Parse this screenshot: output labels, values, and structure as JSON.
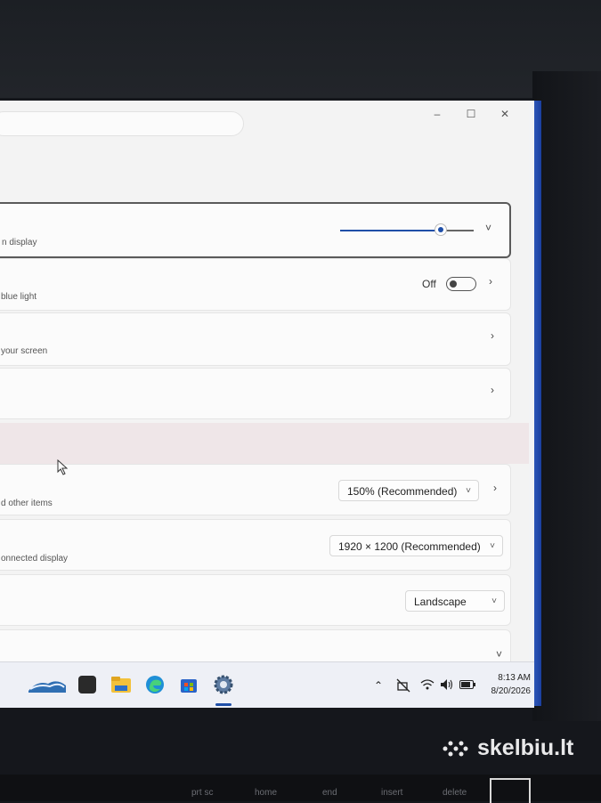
{
  "window": {
    "minimize_glyph": "–",
    "maximize_glyph": "☐",
    "close_glyph": "✕"
  },
  "brightness": {
    "subtitle": "n display",
    "level_percent": 80
  },
  "night_light": {
    "subtitle": "blue light",
    "state_label": "Off"
  },
  "hdr": {
    "subtitle": "your screen"
  },
  "scale": {
    "subtitle": "d other items",
    "value": "150% (Recommended)"
  },
  "resolution": {
    "subtitle": "onnected display",
    "value": "1920 × 1200 (Recommended)"
  },
  "orientation": {
    "value": "Landscape"
  },
  "glyphs": {
    "chevron_right": "›",
    "chevron_down": "˅"
  },
  "taskbar": {
    "icons": [
      "widgets-icon",
      "task-view-icon",
      "file-explorer-icon",
      "edge-icon",
      "store-icon",
      "settings-icon"
    ],
    "time": "8:13 AM",
    "date": "8/20/2026"
  },
  "watermark": "skelbiu.lt",
  "keys": [
    "prt sc",
    "home",
    "end",
    "insert",
    "delete"
  ],
  "colors": {
    "accent": "#1f4fa8",
    "taskbar": "#eef0f6",
    "screen_edge": "#3a66c9"
  }
}
